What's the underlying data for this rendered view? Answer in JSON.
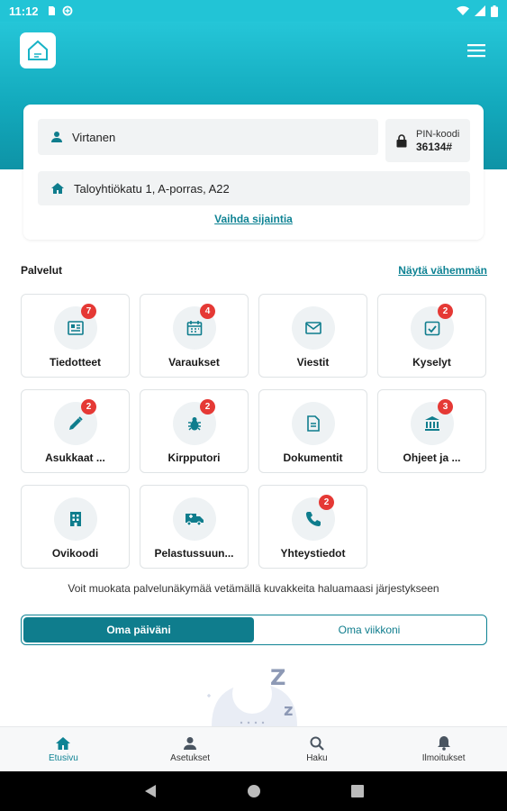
{
  "status_bar": {
    "time": "11:12"
  },
  "user": {
    "name": "Virtanen",
    "pin_label": "PIN-koodi",
    "pin_code": "36134#",
    "address": "Taloyhtiökatu 1, A-porras, A22",
    "change_location": "Vaihda sijaintia"
  },
  "services": {
    "title": "Palvelut",
    "toggle": "Näytä vähemmän",
    "tiles": [
      {
        "label": "Tiedotteet",
        "icon": "newspaper-icon",
        "badge": "7"
      },
      {
        "label": "Varaukset",
        "icon": "calendar-icon",
        "badge": "4"
      },
      {
        "label": "Viestit",
        "icon": "mail-icon",
        "badge": ""
      },
      {
        "label": "Kyselyt",
        "icon": "checkbox-icon",
        "badge": "2"
      },
      {
        "label": "Asukkaat ...",
        "icon": "pencil-icon",
        "badge": "2"
      },
      {
        "label": "Kirpputori",
        "icon": "bug-icon",
        "badge": "2"
      },
      {
        "label": "Dokumentit",
        "icon": "document-icon",
        "badge": ""
      },
      {
        "label": "Ohjeet ja ...",
        "icon": "bank-icon",
        "badge": "3"
      },
      {
        "label": "Ovikoodi",
        "icon": "building-icon",
        "badge": ""
      },
      {
        "label": "Pelastussuun...",
        "icon": "ambulance-icon",
        "badge": ""
      },
      {
        "label": "Yhteystiedot",
        "icon": "phone-icon",
        "badge": "2"
      }
    ],
    "hint": "Voit muokata palvelunäkymää vetämällä kuvakkeita haluamaasi järjestykseen"
  },
  "segment": {
    "active": "Oma päiväni",
    "inactive": "Oma viikkoni"
  },
  "bottom_nav": [
    {
      "label": "Etusivu",
      "icon": "home-icon"
    },
    {
      "label": "Asetukset",
      "icon": "person-icon"
    },
    {
      "label": "Haku",
      "icon": "search-icon"
    },
    {
      "label": "Ilmoitukset",
      "icon": "bell-icon"
    }
  ],
  "colors": {
    "accent": "#0f8394",
    "header": "#13aabd",
    "badge": "#e53935"
  }
}
